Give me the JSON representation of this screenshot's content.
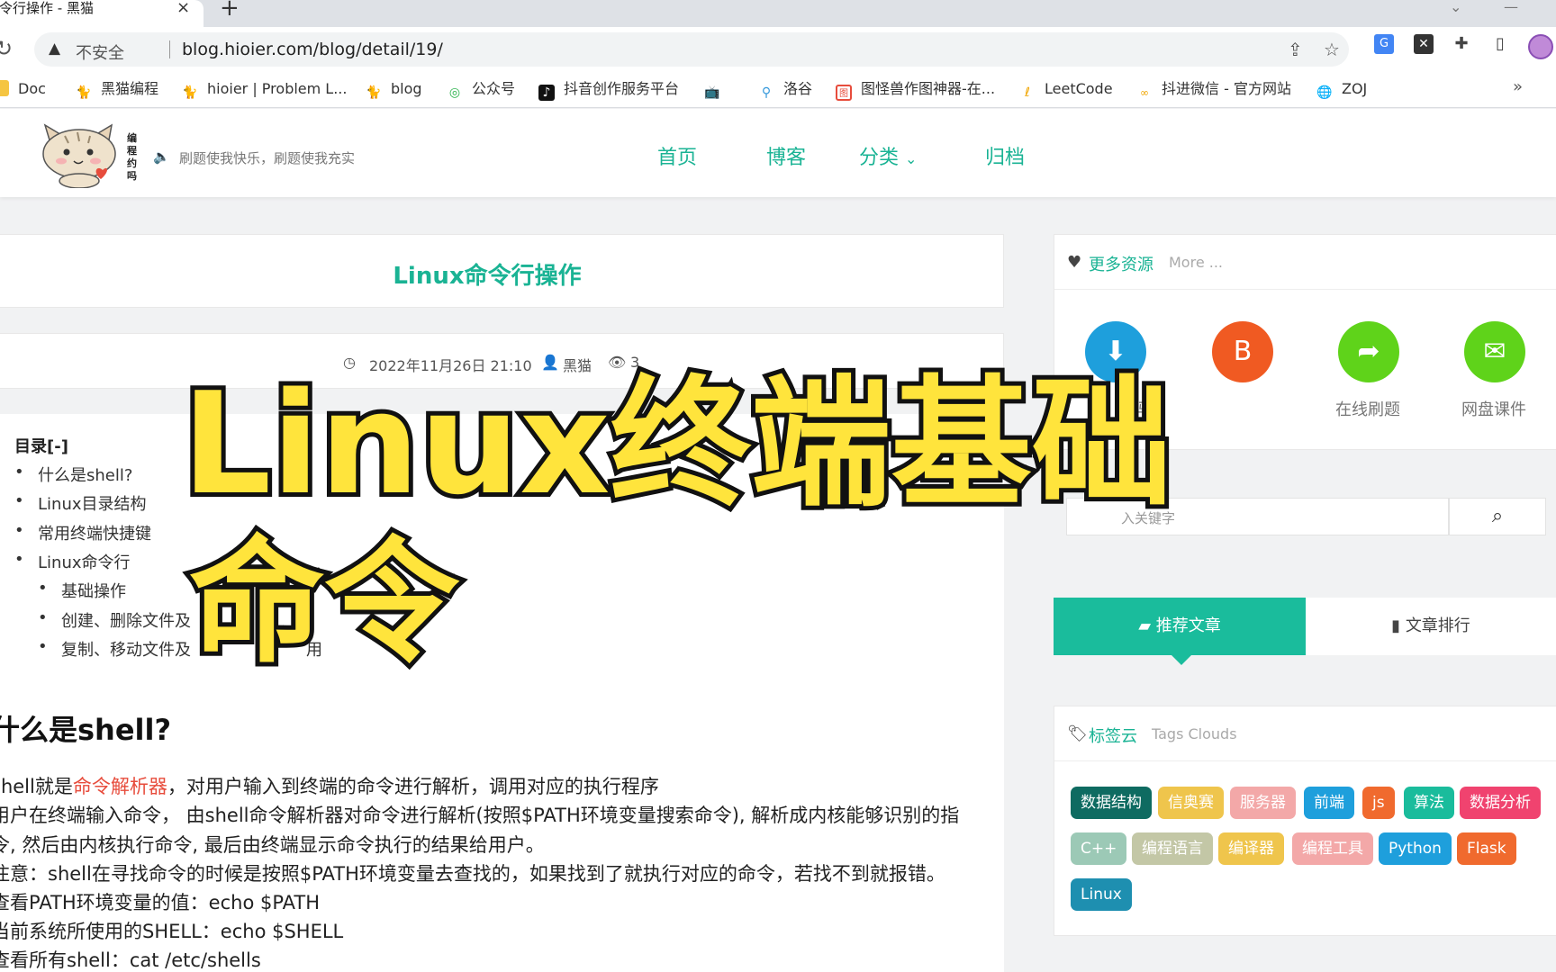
{
  "browser": {
    "tab_title": "命令行操作 - 黑猫",
    "tab_close": "×",
    "new_tab": "+",
    "insecure_label": "不安全",
    "url": "blog.hioier.com/blog/detail/19/",
    "bookmarks": [
      "Doc",
      "黑猫编程",
      "hioier | Problem L...",
      "blog",
      "公众号",
      "抖音创作服务平台",
      "",
      "洛谷",
      "图怪兽作图神器-在...",
      "LeetCode",
      "抖进微信 - 官方网站",
      "ZOJ"
    ],
    "bookmarks_more": "»"
  },
  "header": {
    "logo_text": "编程约吗",
    "motto": "刷题使我快乐，刷题使我充实",
    "nav": [
      "首页",
      "博客",
      "分类",
      "归档"
    ]
  },
  "post": {
    "title": "Linux命令行操作",
    "date": "2022年11月26日 21:10",
    "author": "黑猫",
    "views": "3",
    "toc_title": "目录[-]",
    "toc": [
      "什么是shell?",
      "Linux目录结构",
      "常用终端快捷键",
      "Linux命令行",
      "基础操作",
      "创建、删除文件及",
      "复制、移动文件及"
    ],
    "toc_tail": "用",
    "section_heading": "什么是shell?",
    "para1_pre": "shell就是",
    "para1_hl": "命令解析器",
    "para1_post": "，对用户输入到终端的命令进行解析，调用对应的执行程序",
    "lines": [
      "用户在终端输入命令，  由shell命令解析器对命令进行解析(按照$PATH环境变量搜索命令), 解析成内核能够识别的指",
      "令, 然后由内核执行命令, 最后由终端显示命令执行的结果给用户。",
      "注意：shell在寻找命令的时候是按照$PATH环境变量去查找的，如果找到了就执行对应的命令，若找不到就报错。",
      "查看PATH环境变量的值：echo $PATH",
      "当前系统所使用的SHELL：echo $SHELL",
      "查看所有shell：cat /etc/shells"
    ]
  },
  "sidebar": {
    "resources_title": "更多资源",
    "resources_sub": "More ...",
    "resources": [
      {
        "label": "源码",
        "color": "#1e9fdc",
        "icon": "download-icon"
      },
      {
        "label": "",
        "color": "#f05a22",
        "icon": "blog-icon"
      },
      {
        "label": "在线刷题",
        "color": "#5fd31a",
        "icon": "share-icon"
      },
      {
        "label": "网盘课件",
        "color": "#5fd31a",
        "icon": "mail-icon"
      }
    ],
    "search_placeholder": "入关键字",
    "tab_recommend": "推荐文章",
    "tab_rank": "文章排行",
    "tags_title": "标签云",
    "tags_sub": "Tags Clouds",
    "tags": [
      {
        "label": "数据结构",
        "color": "#0e6b61"
      },
      {
        "label": "信奥赛",
        "color": "#efc54c"
      },
      {
        "label": "服务器",
        "color": "#f3a8a8"
      },
      {
        "label": "前端",
        "color": "#1e9fdc"
      },
      {
        "label": "js",
        "color": "#f06a2e"
      },
      {
        "label": "算法",
        "color": "#1abc9c"
      },
      {
        "label": "数据分析",
        "color": "#f0436f"
      },
      {
        "label": "C++",
        "color": "#9cc9b6"
      },
      {
        "label": "编程语言",
        "color": "#c3c7a6"
      },
      {
        "label": "编译器",
        "color": "#efc54c"
      },
      {
        "label": "编程工具",
        "color": "#f3a8a8"
      },
      {
        "label": "Python",
        "color": "#1e9fdc"
      },
      {
        "label": "Flask",
        "color": "#f06a2e"
      },
      {
        "label": "Linux",
        "color": "#1e8fb0"
      }
    ]
  },
  "overlay": {
    "line1": "Linux终端基础",
    "line2": "命令"
  }
}
